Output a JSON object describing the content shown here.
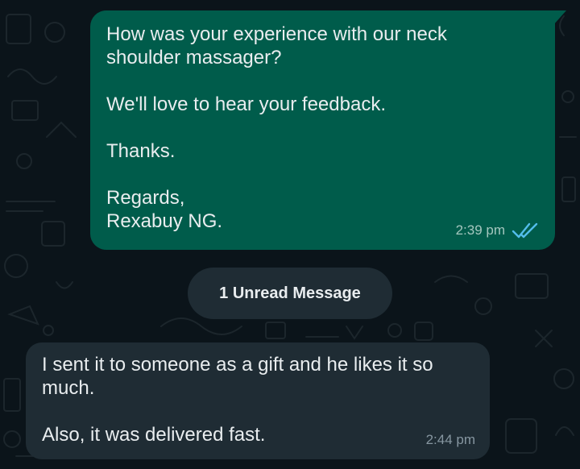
{
  "messages": {
    "outgoing": {
      "lines": [
        "How was your experience with our neck",
        "shoulder massager?",
        "We'll love to hear your feedback.",
        "Thanks.",
        "Regards,",
        "Rexabuy NG."
      ],
      "time": "2:39 pm",
      "status_icon": "double-check-read-icon",
      "status_color": "#53bdeb"
    },
    "unread_label": "1 Unread Message",
    "incoming": {
      "lines": [
        "I sent it to someone as a gift and he likes it so",
        "much.",
        "Also, it was delivered fast."
      ],
      "time": "2:44 pm"
    }
  },
  "colors": {
    "chat_background": "#0b141a",
    "outgoing_bubble": "#005c4b",
    "incoming_bubble": "#1f2c34",
    "text": "#e9edef"
  }
}
